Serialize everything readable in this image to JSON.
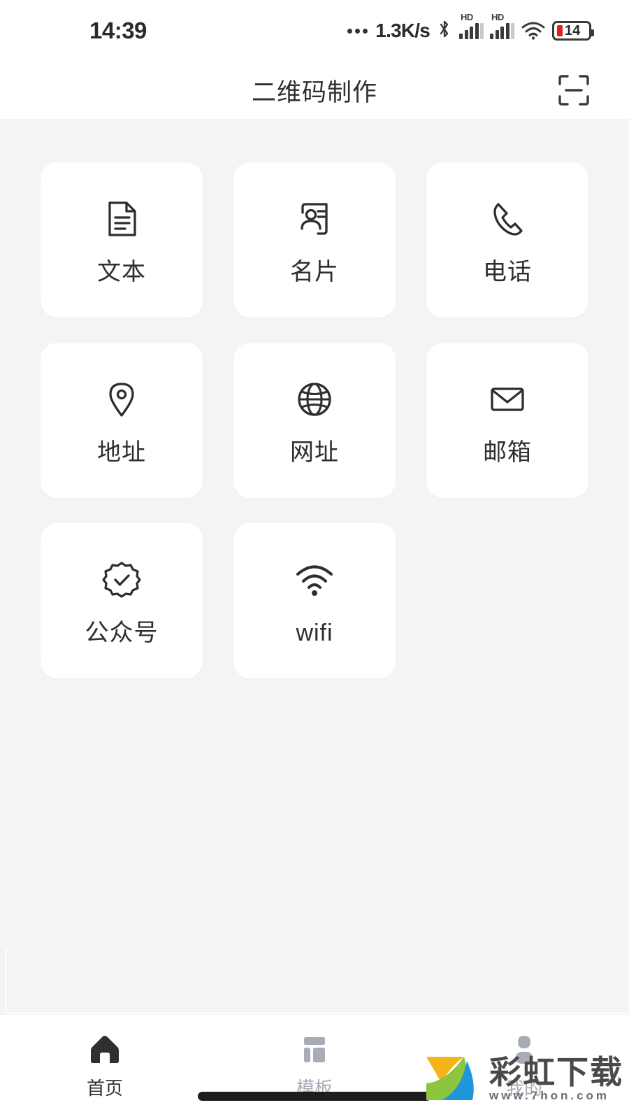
{
  "status_bar": {
    "time": "14:39",
    "network_speed": "1.3K/s",
    "dots_icon": "more-dots-icon",
    "bluetooth_icon": "bluetooth-icon",
    "signal_1_label": "HD",
    "signal_2_label": "HD",
    "wifi_icon": "wifi-icon",
    "battery_level": "14"
  },
  "header": {
    "title": "二维码制作",
    "scan_icon": "scan-qr-icon"
  },
  "grid": {
    "items": [
      {
        "label": "文本",
        "icon": "document-text-icon"
      },
      {
        "label": "名片",
        "icon": "business-card-icon"
      },
      {
        "label": "电话",
        "icon": "phone-icon"
      },
      {
        "label": "地址",
        "icon": "location-pin-icon"
      },
      {
        "label": "网址",
        "icon": "globe-icon"
      },
      {
        "label": "邮箱",
        "icon": "envelope-icon"
      },
      {
        "label": "公众号",
        "icon": "verified-badge-icon"
      },
      {
        "label": "wifi",
        "icon": "wifi-signal-icon"
      }
    ]
  },
  "tabbar": {
    "tabs": [
      {
        "label": "首页",
        "icon": "home-icon",
        "active": true
      },
      {
        "label": "模板",
        "icon": "template-icon",
        "active": false
      },
      {
        "label": "我的",
        "icon": "profile-icon",
        "active": false
      }
    ]
  },
  "watermark": {
    "name": "彩虹下载",
    "url": "www.7hon.com",
    "logo_icon": "rainbow-logo-icon"
  },
  "colors": {
    "page_background": "#f3f4f6",
    "card_background": "#ffffff",
    "text_primary": "#2e2e2e",
    "text_inactive": "#a8acb6",
    "battery_red": "#e02020"
  }
}
